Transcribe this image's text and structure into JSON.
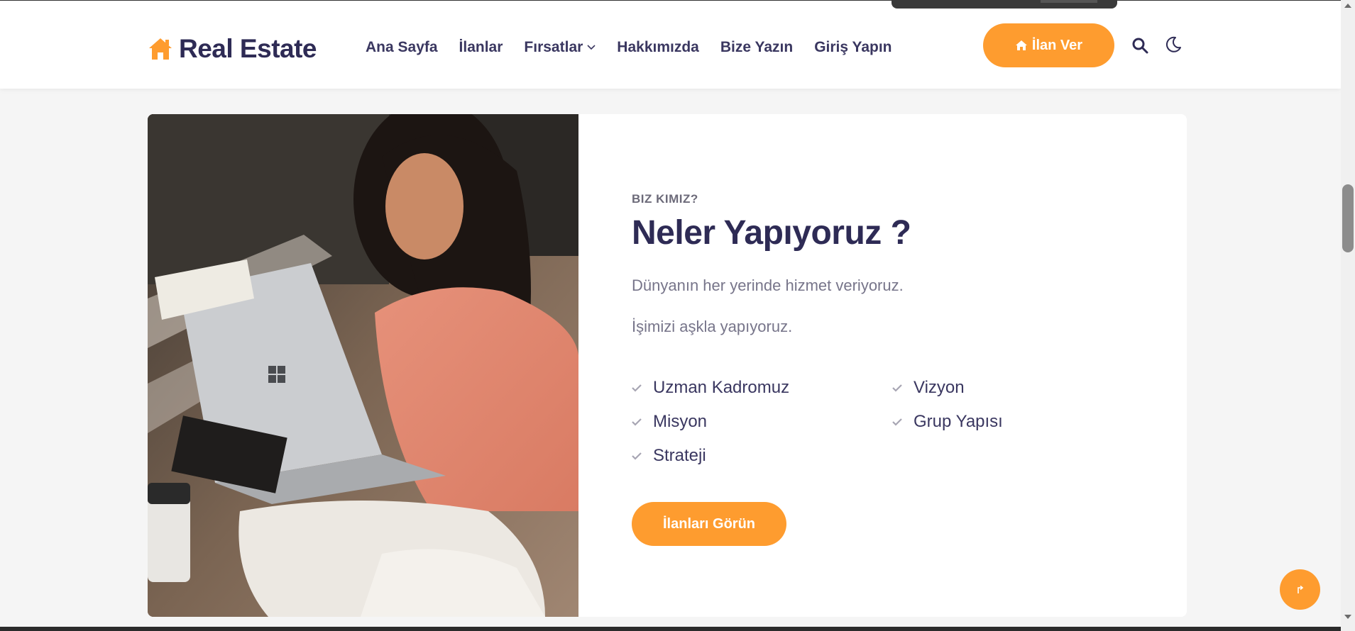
{
  "brand": {
    "name": "Real Estate",
    "icon": "home-icon",
    "accent": "#fe9c2f",
    "text_color": "#2e2b55"
  },
  "nav": {
    "items": [
      {
        "label": "Ana Sayfa"
      },
      {
        "label": "İlanlar"
      },
      {
        "label": "Fırsatlar",
        "has_dropdown": true
      },
      {
        "label": "Hakkımızda"
      },
      {
        "label": "Bize Yazın"
      },
      {
        "label": "Giriş Yapın"
      }
    ],
    "cta_label": "İlan Ver",
    "cta_icon": "home-icon",
    "search_icon": "search-icon",
    "theme_icon": "moon-icon"
  },
  "about": {
    "eyebrow": "BIZ KIMIZ?",
    "title": "Neler Yapıyoruz ?",
    "paragraphs": [
      "Dünyanın her yerinde hizmet veriyoruz.",
      "İşimizi aşkla yapıyoruz."
    ],
    "features": [
      "Uzman Kadromuz",
      "Vizyon",
      "Misyon",
      "Grup Yapısı",
      "Strateji"
    ],
    "button_label": "İlanları Görün"
  },
  "back_to_top_icon": "arrow-up-icon"
}
